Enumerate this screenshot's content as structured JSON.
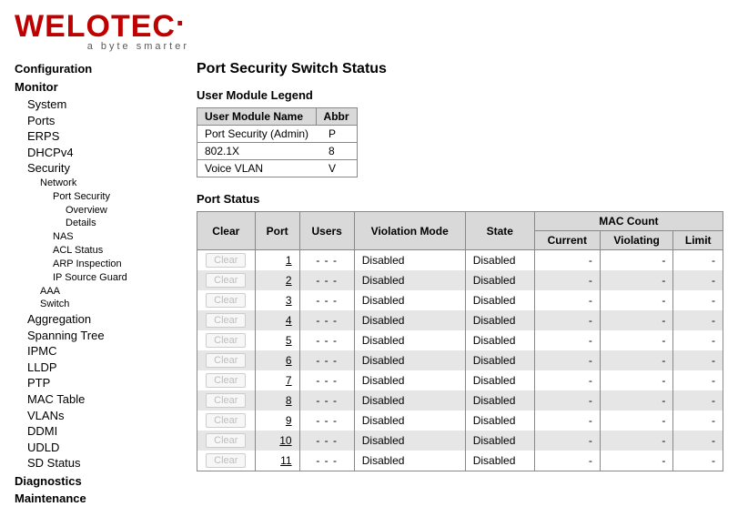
{
  "brand": "WELOTEC",
  "brand_accent_dot": "·",
  "tagline": "a byte smarter",
  "nav": {
    "top": [
      {
        "label": "Configuration",
        "cls": "h1"
      },
      {
        "label": "Monitor",
        "cls": "h1"
      },
      {
        "label": "System",
        "cls": "lvl1"
      },
      {
        "label": "Ports",
        "cls": "lvl1"
      },
      {
        "label": "ERPS",
        "cls": "lvl1"
      },
      {
        "label": "DHCPv4",
        "cls": "lvl1"
      },
      {
        "label": "Security",
        "cls": "lvl1"
      },
      {
        "label": "Network",
        "cls": "lvl2"
      },
      {
        "label": "Port Security",
        "cls": "lvl3"
      },
      {
        "label": "Overview",
        "cls": "lvl4"
      },
      {
        "label": "Details",
        "cls": "lvl4"
      },
      {
        "label": "NAS",
        "cls": "lvl3"
      },
      {
        "label": "ACL Status",
        "cls": "lvl3"
      },
      {
        "label": "ARP Inspection",
        "cls": "lvl3"
      },
      {
        "label": "IP Source Guard",
        "cls": "lvl3"
      },
      {
        "label": "AAA",
        "cls": "lvl2"
      },
      {
        "label": "Switch",
        "cls": "lvl2"
      },
      {
        "label": "Aggregation",
        "cls": "lvl1"
      },
      {
        "label": "Spanning Tree",
        "cls": "lvl1"
      },
      {
        "label": "IPMC",
        "cls": "lvl1"
      },
      {
        "label": "LLDP",
        "cls": "lvl1"
      },
      {
        "label": "PTP",
        "cls": "lvl1"
      },
      {
        "label": "MAC Table",
        "cls": "lvl1"
      },
      {
        "label": "VLANs",
        "cls": "lvl1"
      },
      {
        "label": "DDMI",
        "cls": "lvl1"
      },
      {
        "label": "UDLD",
        "cls": "lvl1"
      },
      {
        "label": "SD Status",
        "cls": "lvl1"
      },
      {
        "label": "Diagnostics",
        "cls": "h1"
      },
      {
        "label": "Maintenance",
        "cls": "h1"
      }
    ]
  },
  "page_title": "Port Security Switch Status",
  "legend_title": "User Module Legend",
  "legend": {
    "cols": [
      "User Module Name",
      "Abbr"
    ],
    "rows": [
      {
        "name": "Port Security (Admin)",
        "abbr": "P"
      },
      {
        "name": "802.1X",
        "abbr": "8"
      },
      {
        "name": "Voice VLAN",
        "abbr": "V"
      }
    ]
  },
  "ports_title": "Port Status",
  "ports": {
    "cols": {
      "clear": "Clear",
      "port": "Port",
      "users": "Users",
      "vmode": "Violation Mode",
      "state": "State",
      "mac_group": "MAC Count",
      "current": "Current",
      "violating": "Violating",
      "limit": "Limit"
    },
    "clear_label": "Clear",
    "rows": [
      {
        "port": "1",
        "users": "- - -",
        "vmode": "Disabled",
        "state": "Disabled",
        "current": "-",
        "violating": "-",
        "limit": "-"
      },
      {
        "port": "2",
        "users": "- - -",
        "vmode": "Disabled",
        "state": "Disabled",
        "current": "-",
        "violating": "-",
        "limit": "-"
      },
      {
        "port": "3",
        "users": "- - -",
        "vmode": "Disabled",
        "state": "Disabled",
        "current": "-",
        "violating": "-",
        "limit": "-"
      },
      {
        "port": "4",
        "users": "- - -",
        "vmode": "Disabled",
        "state": "Disabled",
        "current": "-",
        "violating": "-",
        "limit": "-"
      },
      {
        "port": "5",
        "users": "- - -",
        "vmode": "Disabled",
        "state": "Disabled",
        "current": "-",
        "violating": "-",
        "limit": "-"
      },
      {
        "port": "6",
        "users": "- - -",
        "vmode": "Disabled",
        "state": "Disabled",
        "current": "-",
        "violating": "-",
        "limit": "-"
      },
      {
        "port": "7",
        "users": "- - -",
        "vmode": "Disabled",
        "state": "Disabled",
        "current": "-",
        "violating": "-",
        "limit": "-"
      },
      {
        "port": "8",
        "users": "- - -",
        "vmode": "Disabled",
        "state": "Disabled",
        "current": "-",
        "violating": "-",
        "limit": "-"
      },
      {
        "port": "9",
        "users": "- - -",
        "vmode": "Disabled",
        "state": "Disabled",
        "current": "-",
        "violating": "-",
        "limit": "-"
      },
      {
        "port": "10",
        "users": "- - -",
        "vmode": "Disabled",
        "state": "Disabled",
        "current": "-",
        "violating": "-",
        "limit": "-"
      },
      {
        "port": "11",
        "users": "- - -",
        "vmode": "Disabled",
        "state": "Disabled",
        "current": "-",
        "violating": "-",
        "limit": "-"
      }
    ]
  }
}
